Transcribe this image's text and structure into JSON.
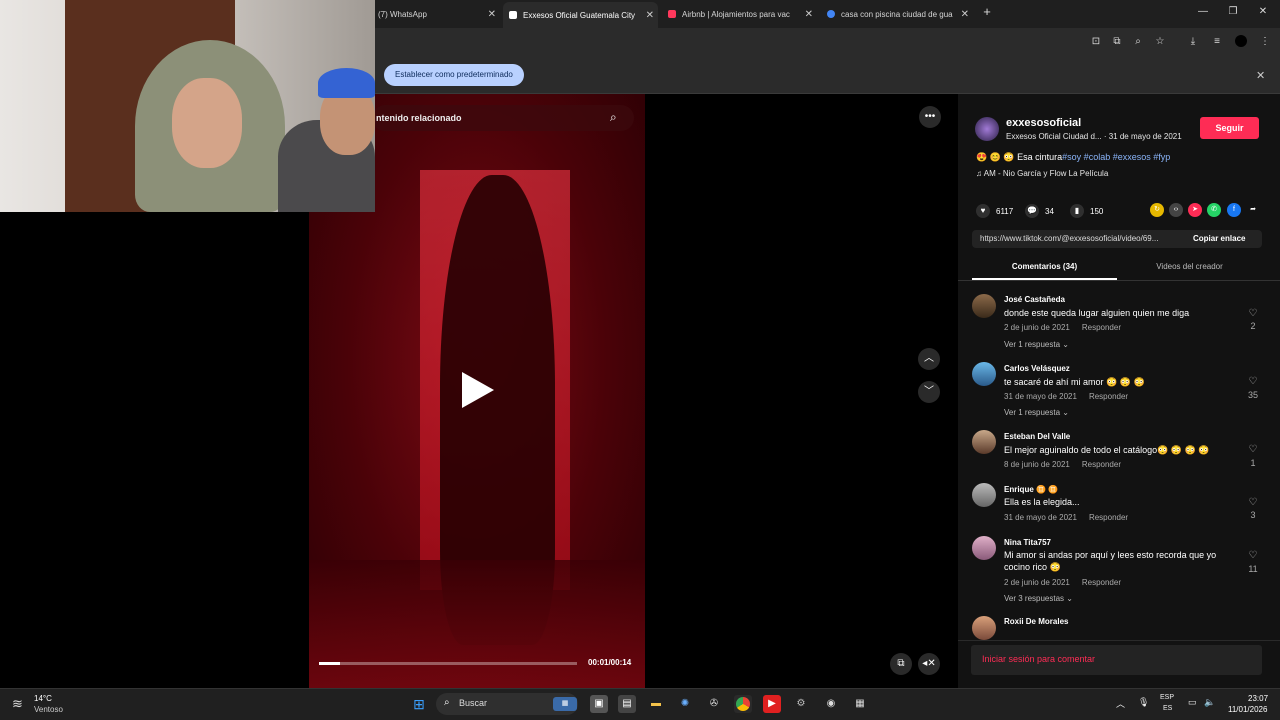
{
  "browser": {
    "tabs": [
      {
        "label": "(7) WhatsApp",
        "color": "#25d366"
      },
      {
        "label": "Exxesos Oficial Guatemala City",
        "color": "#ffffff",
        "active": true
      },
      {
        "label": "Airbnb | Alojamientos para vac",
        "color": "#ff385c"
      },
      {
        "label": "casa con piscina ciudad de gua",
        "color": "#4285f4"
      }
    ],
    "new_tab": "+",
    "set_default_label": "Establecer como predeterminado"
  },
  "video": {
    "search_label": "ntenido relacionado",
    "time": "00:01/00:14",
    "progress_fraction": 0.08
  },
  "post": {
    "username": "exxesosoficial",
    "display_name": "Exxesos Oficial Ciudad d...",
    "date": "31 de mayo de 2021",
    "follow_label": "Seguir",
    "caption_emoji": "😍 😊 😳",
    "caption_text": "Esa cintura",
    "caption_tags": "#soy #colab #exxesos #fyp",
    "music": "AM - Nio García y Flow La Película",
    "likes": "6117",
    "comments": "34",
    "saves": "150",
    "url": "https://www.tiktok.com/@exxesosoficial/video/69...",
    "copy_link_label": "Copiar enlace",
    "tab_comments": "Comentarios (34)",
    "tab_creator": "Videos del creador"
  },
  "comments": [
    {
      "name": "José Castañeda",
      "text": "donde este queda lugar alguien quien me diga",
      "date": "2 de junio de 2021",
      "reply": "Responder",
      "replies": "Ver 1 respuesta ⌄",
      "likes": "2"
    },
    {
      "name": "Carlos Velásquez",
      "text": "te sacaré de ahí mi amor 😳 😳 😳",
      "date": "31 de mayo de 2021",
      "reply": "Responder",
      "replies": "Ver 1 respuesta ⌄",
      "likes": "35"
    },
    {
      "name": "Esteban Del Valle",
      "text": "El mejor aguinaldo de todo el catálogo😳 😳 😳 😳",
      "date": "8 de junio de 2021",
      "reply": "Responder",
      "replies": "",
      "likes": "1"
    },
    {
      "name": "Enrique ♊ ♊",
      "text": "Ella es la elegida...",
      "date": "31 de mayo de 2021",
      "reply": "Responder",
      "replies": "",
      "likes": "3"
    },
    {
      "name": "Nina Tita757",
      "text": "Mi amor si andas por aquí y lees esto recorda que yo cocino rico 😳",
      "date": "2 de junio de 2021",
      "reply": "Responder",
      "replies": "Ver 3 respuestas ⌄",
      "likes": "11"
    },
    {
      "name": "Roxii De Morales",
      "text": "",
      "date": "",
      "reply": "",
      "replies": "",
      "likes": ""
    }
  ],
  "login_comment": "Iniciar sesión para comentar",
  "taskbar": {
    "temp": "14°C",
    "weather": "Ventoso",
    "search": "Buscar",
    "lang1": "ESP",
    "lang2": "ES",
    "time": "23:07",
    "date": "11/01/2026"
  }
}
